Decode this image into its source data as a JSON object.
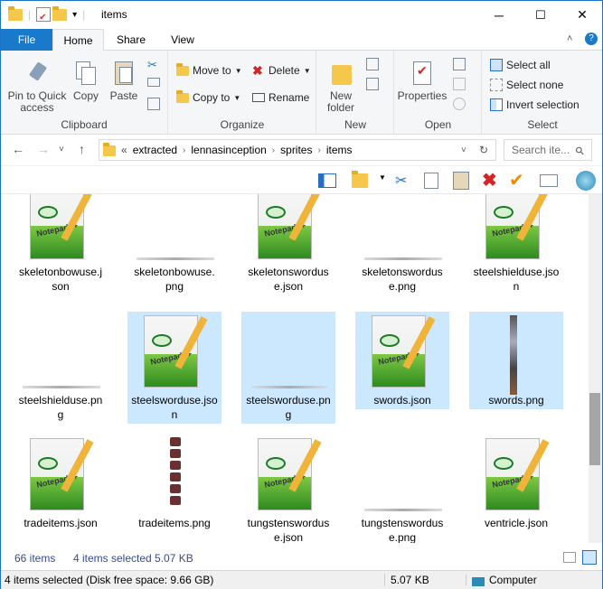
{
  "window": {
    "title": "items",
    "min_glyph": "─",
    "max_glyph": "☐",
    "close_glyph": "✕",
    "help_glyph": "?",
    "collapse_glyph": "˄",
    "qa_dropdown_glyph": "▾",
    "title_sep_glyph": "|"
  },
  "tabs": [
    {
      "label": "File"
    },
    {
      "label": "Home"
    },
    {
      "label": "Share"
    },
    {
      "label": "View"
    }
  ],
  "ribbon": {
    "clipboard": {
      "label": "Clipboard",
      "pin": "Pin to Quick access",
      "copy": "Copy",
      "paste": "Paste"
    },
    "organize": {
      "label": "Organize",
      "move_to": "Move to",
      "copy_to": "Copy to",
      "delete": "Delete",
      "rename": "Rename"
    },
    "new": {
      "label": "New",
      "new_folder": "New folder"
    },
    "open": {
      "label": "Open",
      "properties": "Properties"
    },
    "select": {
      "label": "Select",
      "select_all": "Select all",
      "select_none": "Select none",
      "invert": "Invert selection"
    }
  },
  "address": {
    "overflow": "«",
    "crumbs": [
      "extracted",
      "lennasinception",
      "sprites",
      "items"
    ],
    "search_placeholder": "Search ite...",
    "back_glyph": "←",
    "forward_glyph": "→",
    "recent_glyph": "˅",
    "up_glyph": "↑",
    "crumb_sep_glyph": "›",
    "path_dropdown_glyph": "˅",
    "refresh_glyph": "↻",
    "search_glyph": "⚲"
  },
  "toolbar2": {
    "cut_glyph": "✂",
    "delete_glyph": "✖",
    "check_glyph": "✔"
  },
  "files": [
    {
      "name": "skeletonbowuse.json",
      "l1": "skeletonbowuse.j",
      "l2": "son",
      "type": "json",
      "selected": false
    },
    {
      "name": "skeletonbowuse.png",
      "l1": "skeletonbowuse.",
      "l2": "png",
      "type": "strip",
      "selected": false
    },
    {
      "name": "skeletonswordus e.json",
      "l1": "skeletonswordus",
      "l2": "e.json",
      "type": "json",
      "selected": false
    },
    {
      "name": "skeletonswordus e.png",
      "l1": "skeletonswordus",
      "l2": "e.png",
      "type": "strip",
      "selected": false
    },
    {
      "name": "steelshielduse.json",
      "l1": "steelshielduse.jso",
      "l2": "n",
      "type": "json",
      "selected": false
    },
    {
      "name": "steelshielduse.png",
      "l1": "steelshielduse.pn",
      "l2": "g",
      "type": "strip",
      "selected": false
    },
    {
      "name": "steelsworduse.json",
      "l1": "steelsworduse.jso",
      "l2": "n",
      "type": "json",
      "selected": true
    },
    {
      "name": "steelsworduse.png",
      "l1": "steelsworduse.pn",
      "l2": "g",
      "type": "strip",
      "selected": true
    },
    {
      "name": "swords.json",
      "l1": "swords.json",
      "l2": "",
      "type": "json",
      "selected": true
    },
    {
      "name": "swords.png",
      "l1": "swords.png",
      "l2": "",
      "type": "sword",
      "selected": true
    },
    {
      "name": "tradeitems.json",
      "l1": "tradeitems.json",
      "l2": "",
      "type": "json",
      "selected": false
    },
    {
      "name": "tradeitems.png",
      "l1": "tradeitems.png",
      "l2": "",
      "type": "trade",
      "selected": false
    },
    {
      "name": "tungstenswordus e.json",
      "l1": "tungstenswordus",
      "l2": "e.json",
      "type": "json",
      "selected": false
    },
    {
      "name": "tungstenswordus e.png",
      "l1": "tungstenswordus",
      "l2": "e.png",
      "type": "strip",
      "selected": false
    },
    {
      "name": "ventricle.json",
      "l1": "ventricle.json",
      "l2": "",
      "type": "json",
      "selected": false
    }
  ],
  "status": {
    "count": "66 items",
    "selected": "4 items selected  5.07 KB",
    "bottom_left": "4 items selected (Disk free space: 9.66 GB)",
    "bottom_size": "5.07 KB",
    "bottom_computer": "Computer"
  },
  "colors": {
    "accent": "#1979ca",
    "selection": "#cce8ff"
  }
}
